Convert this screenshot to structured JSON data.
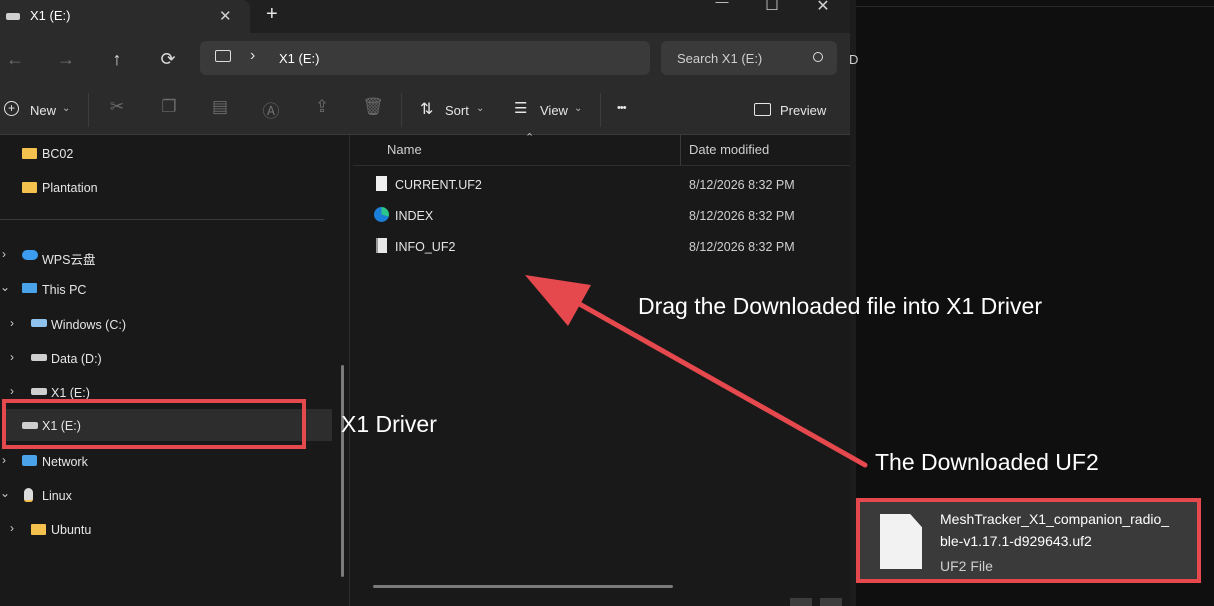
{
  "window": {
    "tab_title": "X1 (E:)",
    "new_tab": "+",
    "minimize": "—",
    "maximize": "☐",
    "close": "✕"
  },
  "navigation": {
    "back": "←",
    "forward": "→",
    "up": "↑",
    "refresh": "⟳",
    "breadcrumb_sep": "›",
    "address": "X1 (E:)",
    "search_placeholder": "Search X1 (E:)"
  },
  "toolbar": {
    "new_label": "New",
    "sort_label": "Sort",
    "view_label": "View",
    "more_label": "•••",
    "preview_label": "Preview"
  },
  "nav_pane": {
    "items": [
      {
        "label": "BC02"
      },
      {
        "label": "Plantation"
      },
      {
        "label": "WPS云盘"
      },
      {
        "label": "This PC"
      },
      {
        "label": "Windows (C:)"
      },
      {
        "label": "Data (D:)"
      },
      {
        "label": "X1 (E:)"
      },
      {
        "label": "X1 (E:)"
      },
      {
        "label": "Network"
      },
      {
        "label": "Linux"
      },
      {
        "label": "Ubuntu"
      }
    ]
  },
  "file_list": {
    "columns": {
      "name": "Name",
      "date": "Date modified"
    },
    "rows": [
      {
        "name": "CURRENT.UF2",
        "date": "8/12/2026 8:32 PM"
      },
      {
        "name": "INDEX",
        "date": "8/12/2026 8:32 PM"
      },
      {
        "name": "INFO_UF2",
        "date": "8/12/2026 8:32 PM"
      }
    ]
  },
  "annotations": {
    "drag_instruction": "Drag the Downloaded file into X1 Driver",
    "x1_driver_label": "X1 Driver",
    "downloaded_label": "The Downloaded UF2"
  },
  "downloaded_file": {
    "name_line1": "MeshTracker_X1_companion_radio_",
    "name_line2": "ble-v1.17.1-d929643.uf2",
    "type": "UF2 File"
  },
  "colors": {
    "highlight_red": "#e5484d",
    "folder_yellow": "#f4c04e"
  }
}
